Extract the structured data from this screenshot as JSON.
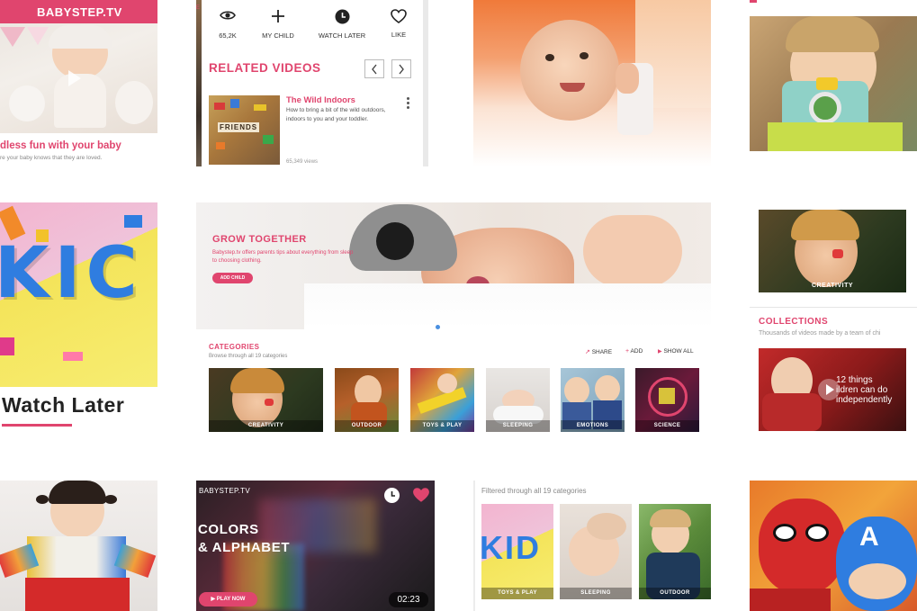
{
  "brand": "BABYSTEP.TV",
  "tile_a": {
    "caption": "dless fun with your baby",
    "subcaption": "re your baby knows that they are loved."
  },
  "player_panel": {
    "actions": [
      {
        "icon": "eye-icon",
        "label": "65,2K"
      },
      {
        "icon": "plus-icon",
        "label": "MY CHILD"
      },
      {
        "icon": "clock-icon",
        "label": "WATCH LATER"
      },
      {
        "icon": "heart-icon",
        "label": "LIKE"
      }
    ],
    "related_title": "RELATED VIDEOS",
    "video": {
      "title": "The Wild Indoors",
      "description": "How to bring a bit of the wild outdoors, indoors to you and your toddler.",
      "views": "65,349 views",
      "tile_letters": "FRIENDS"
    }
  },
  "kids_tile": {
    "letters": "KIC",
    "title": "Watch Later"
  },
  "hero": {
    "title": "GROW TOGETHER",
    "subtitle": "Babystep.tv offers parents tips about everything from sleep to choosing clothing.",
    "button": "ADD CHILD"
  },
  "categories_panel": {
    "title": "CATEGORIES",
    "subtitle": "Browse through all 19 categories",
    "links": [
      "SHARE",
      "ADD",
      "SHOW ALL"
    ],
    "items": [
      "CREATIVITY",
      "OUTDOOR",
      "TOYS & PLAY",
      "SLEEPING",
      "EMOTIONS",
      "SCIENCE"
    ]
  },
  "right_panel": {
    "card_label": "CREATIVITY",
    "collections_title": "COLLECTIONS",
    "collections_subtitle": "Thousands of videos made by a team of chi",
    "collection_video": "12 things\nildren can do\nindependently"
  },
  "player_card": {
    "brand": "BABYSTEP.TV",
    "title_line1": "COLORS",
    "title_line2": "& ALPHABET",
    "button": "PLAY NOW",
    "duration": "02:23"
  },
  "recommended": {
    "subtitle": "Filtered through all 19 categories",
    "items": [
      "TOYS & PLAY",
      "SLEEPING",
      "OUTDOOR"
    ],
    "letters": "KID"
  },
  "colors": {
    "accent": "#e0456e",
    "dark": "#222222"
  }
}
